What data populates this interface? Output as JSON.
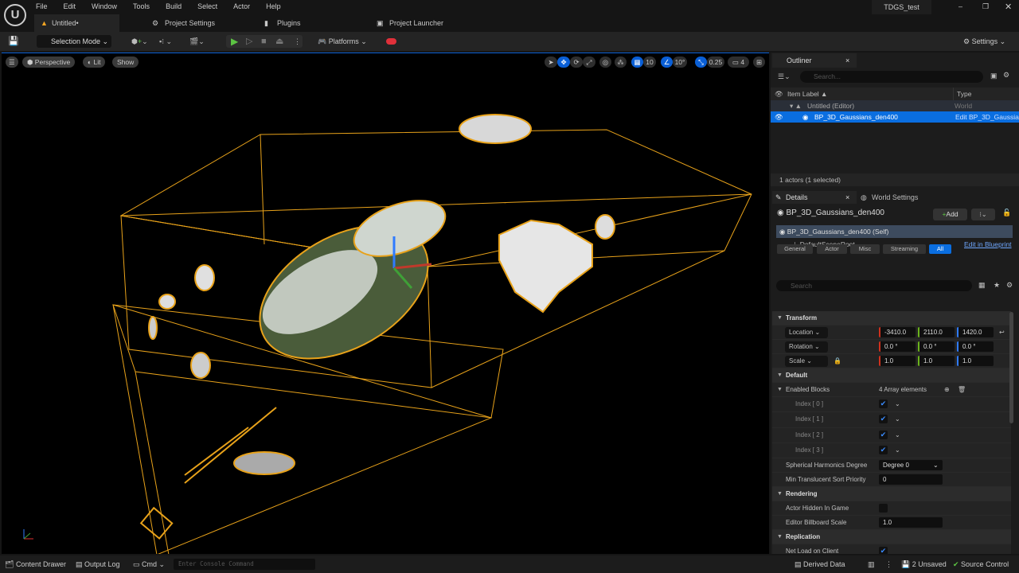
{
  "menu": [
    "File",
    "Edit",
    "Window",
    "Tools",
    "Build",
    "Select",
    "Actor",
    "Help"
  ],
  "project_name": "TDGS_test",
  "tabs": [
    {
      "label": "Untitled•"
    },
    {
      "label": "Project Settings"
    },
    {
      "label": "Plugins"
    },
    {
      "label": "Project Launcher"
    }
  ],
  "toolbar": {
    "selection_mode": "Selection Mode",
    "platforms": "Platforms",
    "settings": "Settings"
  },
  "viewport": {
    "perspective": "Perspective",
    "lit": "Lit",
    "show": "Show",
    "grid_snap": "10",
    "rotation_snap": "10°",
    "scale_snap": "0.25",
    "camera_speed": "4"
  },
  "outliner": {
    "title": "Outliner",
    "search_placeholder": "Search...",
    "col_label": "Item Label ▲",
    "col_type": "Type",
    "rows": [
      {
        "label": "Untitled (Editor)",
        "type": "World"
      },
      {
        "label": "BP_3D_Gaussians_den400",
        "type": "Edit BP_3D_Gaussia"
      }
    ],
    "footer": "1 actors (1 selected)"
  },
  "details": {
    "title": "Details",
    "world_settings": "World Settings",
    "actor": "BP_3D_Gaussians_den400",
    "add": "Add",
    "self": "BP_3D_Gaussians_den400 (Self)",
    "root": "DefaultSceneRoot",
    "edit_bp": "Edit in Blueprint",
    "search_placeholder": "Search",
    "filters": [
      "General",
      "Actor",
      "Misc",
      "Streaming",
      "All"
    ],
    "transform": "Transform",
    "location": {
      "label": "Location",
      "x": "-3410.0",
      "y": "2110.0",
      "z": "1420.0"
    },
    "rotation": {
      "label": "Rotation",
      "x": "0.0 °",
      "y": "0.0 °",
      "z": "0.0 °"
    },
    "scale": {
      "label": "Scale",
      "x": "1.0",
      "y": "1.0",
      "z": "1.0"
    },
    "default": "Default",
    "enabled_blocks": "Enabled Blocks",
    "array_elements": "4 Array elements",
    "indices": [
      "Index [ 0 ]",
      "Index [ 1 ]",
      "Index [ 2 ]",
      "Index [ 3 ]"
    ],
    "sh_degree_label": "Spherical Harmonics Degree",
    "sh_degree": "Degree 0",
    "sort_label": "Min Translucent Sort Priority",
    "sort": "0",
    "rendering": "Rendering",
    "hidden_label": "Actor Hidden In Game",
    "billboard_label": "Editor Billboard Scale",
    "billboard": "1.0",
    "replication": "Replication",
    "net_load": "Net Load on Client"
  },
  "status": {
    "content_drawer": "Content Drawer",
    "output_log": "Output Log",
    "cmd": "Cmd",
    "console_placeholder": "Enter Console Command",
    "derived_data": "Derived Data",
    "unsaved": "2 Unsaved",
    "source_control": "Source Control"
  },
  "colors": {
    "accent": "#0a5fd6",
    "selection": "#f5a623",
    "play": "#5cc443"
  }
}
